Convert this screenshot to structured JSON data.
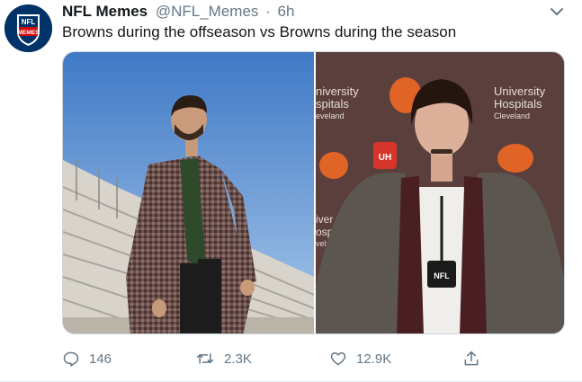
{
  "tweet": {
    "display_name": "NFL Memes",
    "handle": "@NFL_Memes",
    "separator": "·",
    "time": "6h",
    "text": "Browns during the offseason vs Browns during the season",
    "avatar": {
      "brand": "NFL",
      "subtext": "MEMES",
      "colors": {
        "shield": "#013369",
        "stripe": "#d50a0a"
      }
    },
    "media": {
      "left_photo": {
        "description_icon": "photo"
      },
      "right_photo": {
        "backdrop_text": [
          "University",
          "Hospitals",
          "Cleveland"
        ],
        "backdrop_text_left": [
          "niversity",
          "spitals",
          "eveland"
        ],
        "backdrop_text_left_lower": [
          "iver",
          "ospi",
          "vela"
        ],
        "backdrop_badge": "UH",
        "mic_flag": "NFL"
      }
    },
    "actions": {
      "reply_count": "146",
      "retweet_count": "2.3K",
      "like_count": "12.9K"
    }
  },
  "colors": {
    "text": "#14171a",
    "muted": "#657786",
    "border": "#e6ecf0"
  }
}
